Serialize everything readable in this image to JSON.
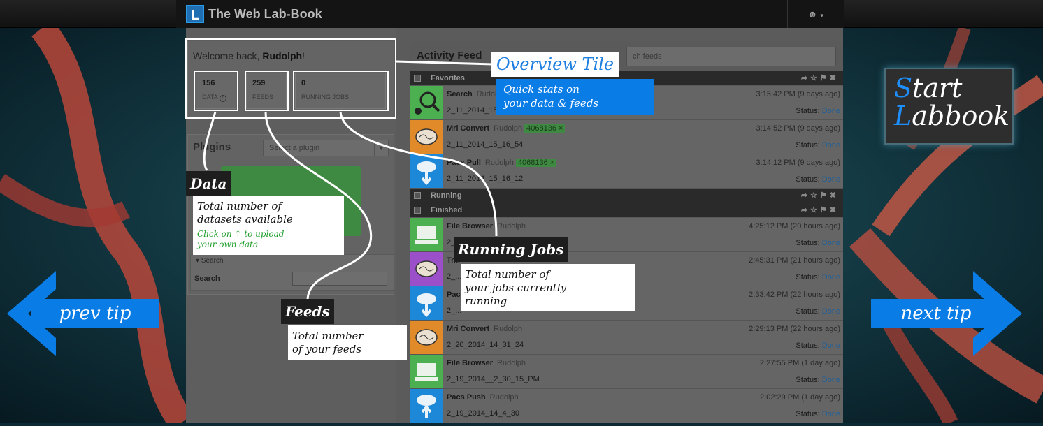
{
  "topbar": {
    "logo_letter": "L",
    "app_title": "The Web Lab-Book",
    "user_menu_icon": "user-icon"
  },
  "overview": {
    "welcome_prefix": "Welcome back, ",
    "user_name": "Rudolph",
    "welcome_suffix": "!",
    "stats": [
      {
        "value": "156",
        "label": "DATA"
      },
      {
        "value": "259",
        "label": "FEEDS"
      },
      {
        "value": "0",
        "label": "RUNNING JOBS"
      }
    ]
  },
  "plugins": {
    "title": "Plugins",
    "select_placeholder": "Select a plugin",
    "search_toggle": "▾ Search",
    "search_label": "Search"
  },
  "activity_feed": {
    "title": "Activity Feed",
    "search_placeholder": "ch feeds",
    "sections": {
      "favorites": "Favorites",
      "running": "Running",
      "finished": "Finished"
    },
    "status_label": "Status: ",
    "favorites": [
      {
        "name": "Search",
        "user": "Rudolph",
        "tag": "",
        "sub": "2_11_2014_15_...",
        "time": "3:15:42 PM (9 days ago)",
        "status": "Done",
        "icon": "search-plugin-icon",
        "color": "#4caf50"
      },
      {
        "name": "Mri Convert",
        "user": "Rudolph",
        "tag": "4068136 ×",
        "sub": "2_11_2014_15_16_54",
        "time": "3:14:52 PM (9 days ago)",
        "status": "Done",
        "icon": "brain-icon",
        "color": "#e08a2a"
      },
      {
        "name": "Pacs Pull",
        "user": "Rudolph",
        "tag": "4068136 ×",
        "sub": "2_11_2014_15_16_12",
        "time": "3:14:12 PM (9 days ago)",
        "status": "Done",
        "icon": "cloud-download-icon",
        "color": "#1e88d8"
      }
    ],
    "finished": [
      {
        "name": "File Browser",
        "user": "Rudolph",
        "tag": "",
        "sub": "2_...",
        "time": "4:25:12 PM (20 hours ago)",
        "status": "Done",
        "icon": "folder-icon",
        "color": "#4caf50"
      },
      {
        "name": "Tr...",
        "user": "",
        "tag": "",
        "sub": "2_...",
        "time": "2:45:31 PM (21 hours ago)",
        "status": "Done",
        "icon": "brain-icon",
        "color": "#9b4fc8"
      },
      {
        "name": "Pac...",
        "user": "",
        "tag": "",
        "sub": "2_...",
        "time": "2:33:42 PM (22 hours ago)",
        "status": "Done",
        "icon": "cloud-download-icon",
        "color": "#1e88d8"
      },
      {
        "name": "Mri Convert",
        "user": "Rudolph",
        "tag": "",
        "sub": "2_20_2014_14_31_24",
        "time": "2:29:13 PM (22 hours ago)",
        "status": "Done",
        "icon": "brain-icon",
        "color": "#e08a2a"
      },
      {
        "name": "File Browser",
        "user": "Rudolph",
        "tag": "",
        "sub": "2_19_2014__2_30_15_PM",
        "time": "2:27:55 PM (1 day ago)",
        "status": "Done",
        "icon": "folder-icon",
        "color": "#4caf50"
      },
      {
        "name": "Pacs Push",
        "user": "Rudolph",
        "tag": "",
        "sub": "2_19_2014_14_4_30",
        "time": "2:02:29 PM (1 day ago)",
        "status": "Done",
        "icon": "cloud-upload-icon",
        "color": "#1e88d8"
      }
    ]
  },
  "tour": {
    "overview_title": "Overview Tile",
    "overview_body_1": "Quick stats on",
    "overview_body_2": "your data & feeds",
    "data_title": "Data",
    "data_body_1": "Total number of",
    "data_body_2": "datasets available",
    "data_hint_1": "Click on ↑ to upload",
    "data_hint_2": "your own data",
    "feeds_title": "Feeds",
    "feeds_body_1": "Total number",
    "feeds_body_2": "of your feeds",
    "jobs_title": "Running Jobs",
    "jobs_body_1": "Total number of",
    "jobs_body_2": "your jobs currently",
    "jobs_body_3": "running",
    "start_1a": "S",
    "start_1b": "tart",
    "start_2a": "L",
    "start_2b": "abbook",
    "prev": "prev tip",
    "next": "next tip"
  },
  "colors": {
    "accent_blue": "#0a7ce6",
    "done_link": "#1f5f9a",
    "tag_green": "#3f8a42"
  }
}
